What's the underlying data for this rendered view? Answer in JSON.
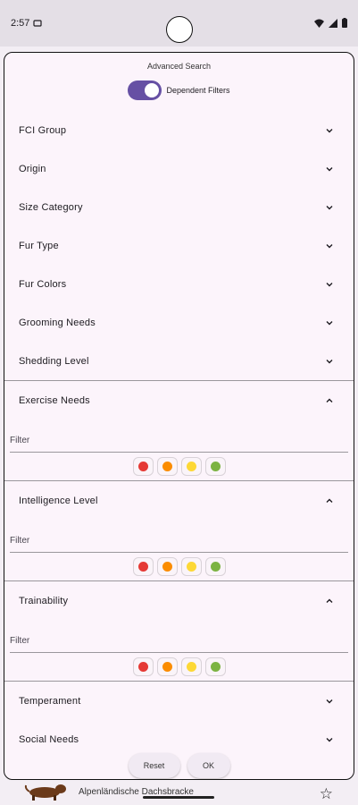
{
  "status_bar": {
    "time": "2:57"
  },
  "dialog": {
    "title": "Advanced Search",
    "toggle_label": "Dependent Filters",
    "toggle_on": true,
    "collapsed_top": [
      "FCI Group",
      "Origin",
      "Size Category",
      "Fur Type",
      "Fur Colors",
      "Grooming Needs",
      "Shedding Level"
    ],
    "expanded": [
      {
        "label": "Exercise Needs",
        "filter_label": "Filter"
      },
      {
        "label": "Intelligence Level",
        "filter_label": "Filter"
      },
      {
        "label": "Trainability",
        "filter_label": "Filter"
      }
    ],
    "collapsed_bottom": [
      "Temperament",
      "Social Needs"
    ],
    "level_colors": [
      "#e53935",
      "#fb8c00",
      "#fdd835",
      "#7cb342"
    ],
    "reset_label": "Reset",
    "ok_label": "OK"
  },
  "background": {
    "dog_name": "Alpenländische Dachsbracke"
  },
  "colors": {
    "accent": "#6650a4",
    "surface": "#fcf4fb"
  }
}
